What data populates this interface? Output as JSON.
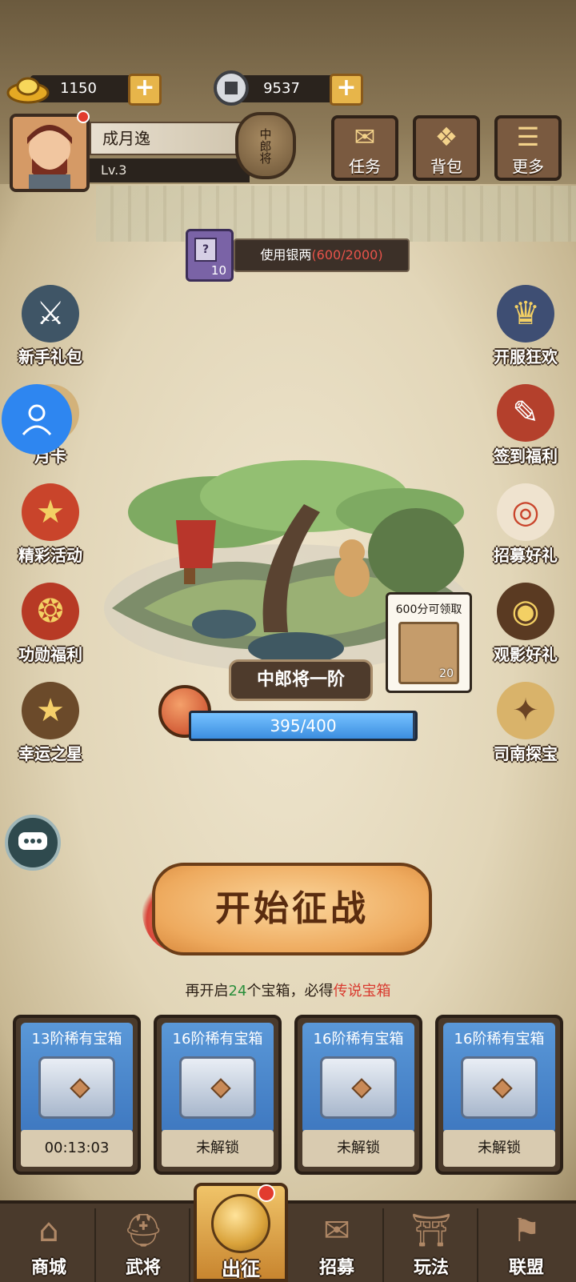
{
  "currency": {
    "gold": {
      "icon": "gold-ingot-icon",
      "value": "1150"
    },
    "silver": {
      "icon": "copper-coin-icon",
      "value": "9537"
    },
    "plus_label": "+"
  },
  "player": {
    "name": "成月逸",
    "level": "Lv.3",
    "rank": "中郎将"
  },
  "top_buttons": [
    {
      "label": "任务",
      "icon": "scroll-icon"
    },
    {
      "label": "背包",
      "icon": "bag-icon"
    },
    {
      "label": "更多",
      "icon": "menu-icon"
    }
  ],
  "silver_task": {
    "card_count": "10",
    "card_mark": "?",
    "text": "使用银两",
    "progress": "(600/2000)"
  },
  "left_icons": [
    {
      "label": "新手礼包"
    },
    {
      "label": "月卡"
    },
    {
      "label": "精彩活动"
    },
    {
      "label": "功勋福利"
    },
    {
      "label": "幸运之星"
    }
  ],
  "right_icons": [
    {
      "label": "开服狂欢"
    },
    {
      "label": "签到福利"
    },
    {
      "label": "招募好礼"
    },
    {
      "label": "观影好礼"
    },
    {
      "label": "司南探宝"
    }
  ],
  "stage": {
    "label": "中郎将一阶",
    "exp_text": "395/400",
    "exp_fraction": 0.9875
  },
  "reward_bubble": {
    "text": "600分可领取",
    "count": "20"
  },
  "start_button": "开始征战",
  "chest_tip": {
    "prefix": "再开启",
    "number": "24",
    "middle": "个宝箱，必得",
    "highlight": "传说宝箱"
  },
  "chests": [
    {
      "title": "13阶稀有宝箱",
      "status": "00:13:03"
    },
    {
      "title": "16阶稀有宝箱",
      "status": "未解锁"
    },
    {
      "title": "16阶稀有宝箱",
      "status": "未解锁"
    },
    {
      "title": "16阶稀有宝箱",
      "status": "未解锁"
    }
  ],
  "bottom_nav": [
    {
      "label": "商城"
    },
    {
      "label": "武将"
    },
    {
      "label": "出征"
    },
    {
      "label": "招募"
    },
    {
      "label": "玩法"
    },
    {
      "label": "联盟"
    }
  ]
}
